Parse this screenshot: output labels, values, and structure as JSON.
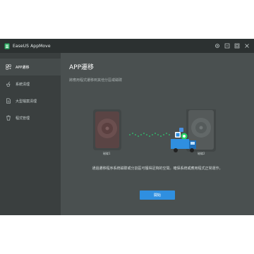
{
  "window": {
    "title": "EaseUS AppMove"
  },
  "sidebar": {
    "items": [
      {
        "label": "APP遷移",
        "icon": "app-transfer-icon",
        "active": true
      },
      {
        "label": "系統清理",
        "icon": "broom-icon",
        "active": false
      },
      {
        "label": "大型檔案清理",
        "icon": "file-cleanup-icon",
        "active": false
      },
      {
        "label": "程式管理",
        "icon": "trash-icon",
        "active": false
      }
    ]
  },
  "main": {
    "title": "APP遷移",
    "subtitle": "將應用程式遷移到其他分區或磁碟",
    "drive_source_label": "磁碟1",
    "drive_target_label": "磁碟2",
    "description": "通過遷移程序系統磁碟或分割區可獲得足夠的空間。確保系統或應用程式正常運作。",
    "start_button": "開始"
  },
  "colors": {
    "window_bg": "#4a5050",
    "sidebar_bg": "#3a3f3f",
    "titlebar_bg": "#2c3131",
    "accent": "#2f8fe0"
  }
}
